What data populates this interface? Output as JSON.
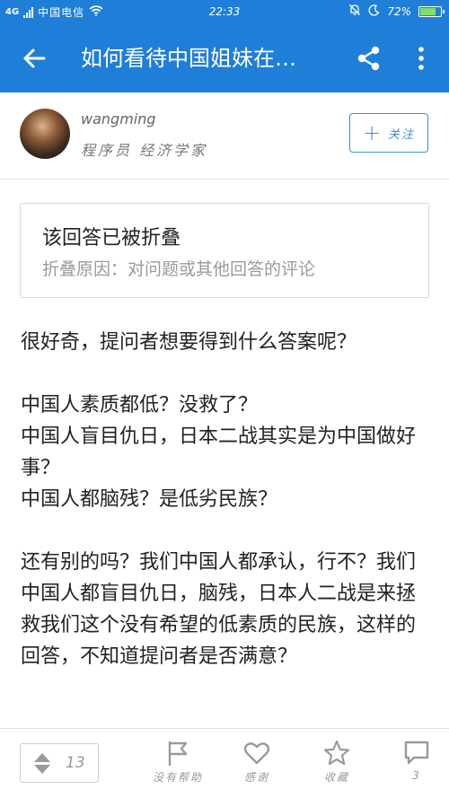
{
  "status_bar": {
    "network": "4G",
    "carrier": "中国电信",
    "time": "22:33",
    "battery": "72%"
  },
  "app_bar": {
    "title": "如何看待中国姐妹在…"
  },
  "author": {
    "name": "wangming",
    "bio": "程序员 经济学家",
    "follow_label": "关注"
  },
  "collapsed_notice": {
    "title": "该回答已被折叠",
    "reason": "折叠原因：对问题或其他回答的评论"
  },
  "answer": {
    "paragraphs": [
      "很好奇，提问者想要得到什么答案呢？",
      "",
      "中国人素质都低？没救了？",
      "中国人盲目仇日，日本二战其实是为中国做好事？",
      "中国人都脑残？是低劣民族？",
      "",
      "还有别的吗？我们中国人都承认，行不？我们中国人都盲目仇日，脑残，日本人二战是来拯救我们这个没有希望的低素质的民族，这样的回答，不知道提问者是否满意？"
    ]
  },
  "bottom_bar": {
    "vote_count": "13",
    "not_helpful_label": "没有帮助",
    "thanks_label": "感谢",
    "favorite_label": "收藏",
    "comments_count": "3"
  },
  "colors": {
    "primary": "#1f7fd8",
    "accent": "#3a8ee0",
    "icon_gray": "#9a9a9a"
  },
  "icons": {
    "back": "arrow-left-icon",
    "share": "share-icon",
    "more": "more-vertical-icon",
    "flag": "flag-icon",
    "heart": "heart-icon",
    "star": "star-icon",
    "comment": "comment-icon"
  }
}
